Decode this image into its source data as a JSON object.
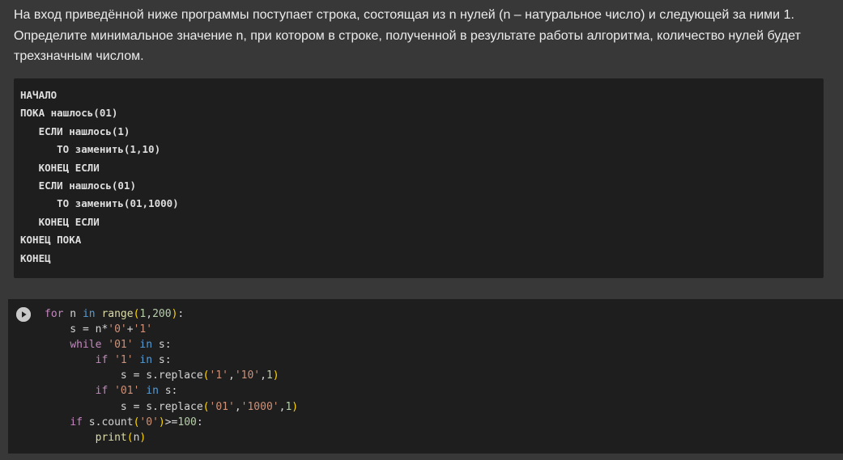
{
  "task": {
    "text": "На вход приведённой ниже программы поступает строка, состоящая из n нулей (n – натуральное число) и следующей за ними 1. Определите минимальное значение n, при котором в строке, полученной в результате работы алгоритма, количество нулей будет трехзначным числом."
  },
  "pseudocode": {
    "lines": [
      "НАЧАЛО",
      "ПОКА нашлось(01)",
      "   ЕСЛИ нашлось(1)",
      "      ТО заменить(1,10)",
      "   КОНЕЦ ЕСЛИ",
      "   ЕСЛИ нашлось(01)",
      "      ТО заменить(01,1000)",
      "   КОНЕЦ ЕСЛИ",
      "КОНЕЦ ПОКА",
      "КОНЕЦ"
    ]
  },
  "code_cell": {
    "run_icon": "play-circle-icon",
    "colors": {
      "background": "#1e1e1e",
      "control_keyword": "#c586c0",
      "operator_keyword": "#569cd6",
      "function": "#dcdcaa",
      "number": "#b5cea8",
      "string": "#ce9178"
    },
    "lines": [
      [
        {
          "c": "kw-ctl",
          "t": "for"
        },
        {
          "c": "",
          "t": " n "
        },
        {
          "c": "kw-in",
          "t": "in"
        },
        {
          "c": "",
          "t": " "
        },
        {
          "c": "fn",
          "t": "range"
        },
        {
          "c": "p1",
          "t": "("
        },
        {
          "c": "num",
          "t": "1"
        },
        {
          "c": "",
          "t": ","
        },
        {
          "c": "num",
          "t": "200"
        },
        {
          "c": "p1",
          "t": ")"
        },
        {
          "c": "",
          "t": ":"
        }
      ],
      [
        {
          "c": "",
          "t": "    s = n*"
        },
        {
          "c": "str",
          "t": "'0'"
        },
        {
          "c": "",
          "t": "+"
        },
        {
          "c": "str",
          "t": "'1'"
        }
      ],
      [
        {
          "c": "",
          "t": "    "
        },
        {
          "c": "kw-ctl",
          "t": "while"
        },
        {
          "c": "",
          "t": " "
        },
        {
          "c": "str",
          "t": "'01'"
        },
        {
          "c": "",
          "t": " "
        },
        {
          "c": "kw-in",
          "t": "in"
        },
        {
          "c": "",
          "t": " s:"
        }
      ],
      [
        {
          "c": "",
          "t": "        "
        },
        {
          "c": "kw-ctl",
          "t": "if"
        },
        {
          "c": "",
          "t": " "
        },
        {
          "c": "str",
          "t": "'1'"
        },
        {
          "c": "",
          "t": " "
        },
        {
          "c": "kw-in",
          "t": "in"
        },
        {
          "c": "",
          "t": " s:"
        }
      ],
      [
        {
          "c": "",
          "t": "            s = s.replace"
        },
        {
          "c": "p1",
          "t": "("
        },
        {
          "c": "str",
          "t": "'1'"
        },
        {
          "c": "",
          "t": ","
        },
        {
          "c": "str",
          "t": "'10'"
        },
        {
          "c": "",
          "t": ","
        },
        {
          "c": "num",
          "t": "1"
        },
        {
          "c": "p1",
          "t": ")"
        }
      ],
      [
        {
          "c": "",
          "t": "        "
        },
        {
          "c": "kw-ctl",
          "t": "if"
        },
        {
          "c": "",
          "t": " "
        },
        {
          "c": "str",
          "t": "'01'"
        },
        {
          "c": "",
          "t": " "
        },
        {
          "c": "kw-in",
          "t": "in"
        },
        {
          "c": "",
          "t": " s:"
        }
      ],
      [
        {
          "c": "",
          "t": "            s = s.replace"
        },
        {
          "c": "p1",
          "t": "("
        },
        {
          "c": "str",
          "t": "'01'"
        },
        {
          "c": "",
          "t": ","
        },
        {
          "c": "str",
          "t": "'1000'"
        },
        {
          "c": "",
          "t": ","
        },
        {
          "c": "num",
          "t": "1"
        },
        {
          "c": "p1",
          "t": ")"
        }
      ],
      [
        {
          "c": "",
          "t": "    "
        },
        {
          "c": "kw-ctl",
          "t": "if"
        },
        {
          "c": "",
          "t": " s.count"
        },
        {
          "c": "p1",
          "t": "("
        },
        {
          "c": "str",
          "t": "'0'"
        },
        {
          "c": "p1",
          "t": ")"
        },
        {
          "c": "",
          "t": ">="
        },
        {
          "c": "num",
          "t": "100"
        },
        {
          "c": "",
          "t": ":"
        }
      ],
      [
        {
          "c": "",
          "t": "        "
        },
        {
          "c": "fn",
          "t": "print"
        },
        {
          "c": "p1",
          "t": "("
        },
        {
          "c": "",
          "t": "n"
        },
        {
          "c": "p1",
          "t": ")"
        }
      ]
    ]
  }
}
